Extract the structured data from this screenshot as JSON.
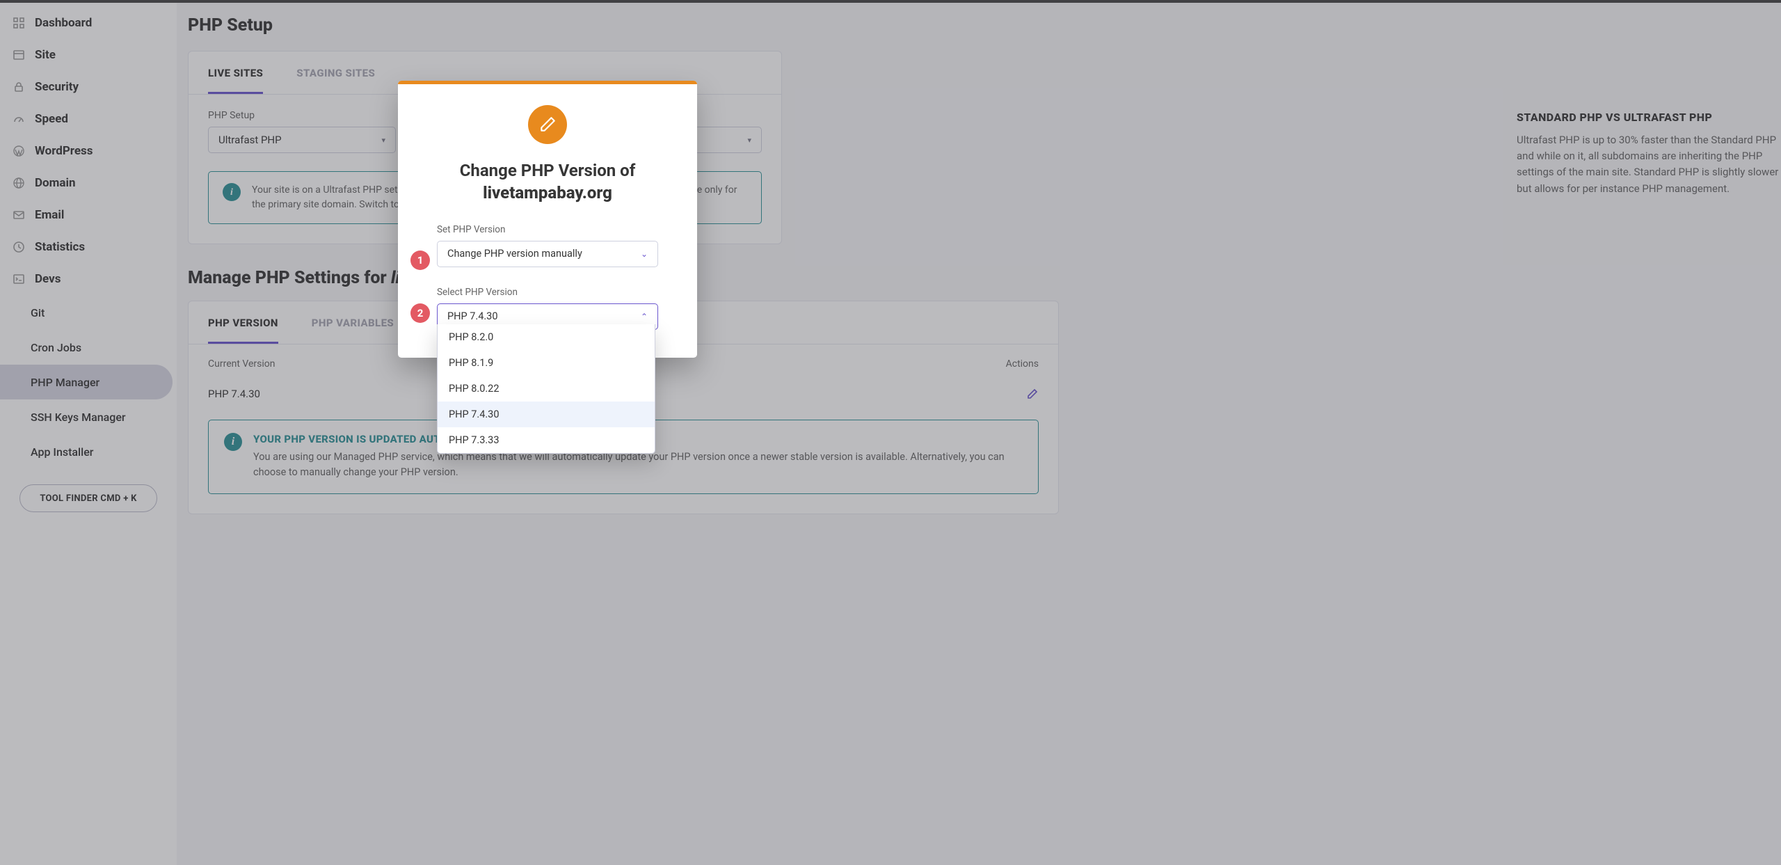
{
  "sidebar": {
    "items": [
      {
        "label": "Dashboard",
        "icon": "grid"
      },
      {
        "label": "Site",
        "icon": "window"
      },
      {
        "label": "Security",
        "icon": "lock"
      },
      {
        "label": "Speed",
        "icon": "gauge"
      },
      {
        "label": "WordPress",
        "icon": "wordpress"
      },
      {
        "label": "Domain",
        "icon": "globe"
      },
      {
        "label": "Email",
        "icon": "mail"
      },
      {
        "label": "Statistics",
        "icon": "clock"
      },
      {
        "label": "Devs",
        "icon": "terminal"
      }
    ],
    "subitems": [
      {
        "label": "Git"
      },
      {
        "label": "Cron Jobs"
      },
      {
        "label": "PHP Manager",
        "active": true
      },
      {
        "label": "SSH Keys Manager"
      },
      {
        "label": "App Installer"
      }
    ],
    "tool_finder": "TOOL FINDER CMD + K"
  },
  "page": {
    "title": "PHP Setup",
    "tabs": [
      "LIVE SITES",
      "STAGING SITES"
    ],
    "active_tab": 0,
    "php_setup_label": "PHP Setup",
    "php_setup_value": "Ultrafast PHP",
    "site_select_value": "",
    "info_text": "Your site is on a Ultrafast PHP setup, which is faster, but PHP management on a domain level is possible only for the primary site domain. Switch to Standard PHP to manage subdomains PHP separately.",
    "right": {
      "title": "STANDARD PHP VS ULTRAFAST PHP",
      "text": "Ultrafast PHP is up to 30% faster than the Standard PHP and while on it, all subdomains are inheriting the PHP settings of the main site. Standard PHP is slightly slower but allows for per instance PHP management."
    },
    "section2_title_prefix": "Manage PHP Settings for ",
    "section2_title_domain": "livetampabay.org",
    "tabs2": [
      "PHP VERSION",
      "PHP VARIABLES"
    ],
    "active_tab2": 0,
    "table": {
      "col1": "Current Version",
      "col2": "Actions",
      "value": "PHP 7.4.30"
    },
    "managed": {
      "title": "YOUR PHP VERSION IS UPDATED AUTOMATICALLY",
      "text": "You are using our Managed PHP service, which means that we will automatically update your PHP version once a newer stable version is available. Alternatively, you can choose to manually change your PHP version."
    }
  },
  "modal": {
    "heading_prefix": "Change PHP Version of",
    "heading_domain": "livetampabay.org",
    "field1_label": "Set PHP Version",
    "field1_value": "Change PHP version manually",
    "field2_label": "Select PHP Version",
    "field2_value": "PHP 7.4.30",
    "options": [
      "PHP 8.2.0",
      "PHP 8.1.9",
      "PHP 8.0.22",
      "PHP 7.4.30",
      "PHP 7.3.33"
    ],
    "selected_option": "PHP 7.4.30",
    "step_badges": [
      "1",
      "2"
    ]
  }
}
